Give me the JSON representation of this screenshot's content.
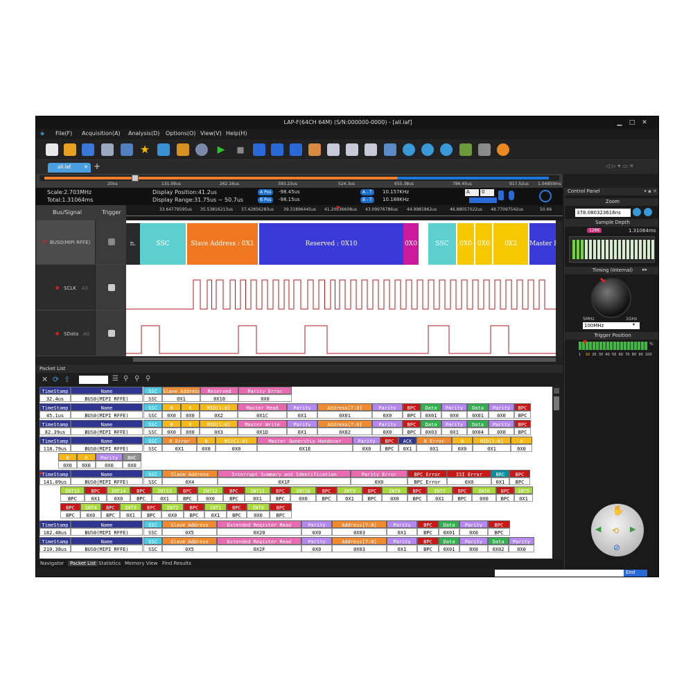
{
  "window": {
    "title": "LAP-F(64CH 64M) (S/N:000000-0000) - [all.laf]"
  },
  "menu": [
    "File(F)",
    "Acquisition(A)",
    "Analysis(D)",
    "Options(O)",
    "View(V)",
    "Help(H)"
  ],
  "tab": {
    "name": "all.laf"
  },
  "ruler": {
    "ticks": [
      "20ns",
      "131.09us",
      "262.16us",
      "393.23us",
      "524.3us",
      "655.38us",
      "786.45us",
      "917.52us",
      "1.04859ms"
    ]
  },
  "info": {
    "scale": "Scale:2.703MHz",
    "total": "Total:1.31064ms",
    "display_position": "Display Position:41.2us",
    "display_range": "Display Range:31.75us ~ 50.7us",
    "a_pos_label": "A Pos",
    "a_pos": "-98.45us",
    "b_pos_label": "B Pos",
    "b_pos": "-98.15us",
    "at_label": "A - T",
    "at": "10.157KHz",
    "bt_label": "B - T",
    "bt": "10.188KHz",
    "sel_a": "A",
    "sel_0": "0"
  },
  "header": {
    "bus_signal": "Bus/Signal",
    "trigger": "Trigger"
  },
  "time_ticks": [
    "33.64779595us",
    "35.53816213us",
    "37.42856283us",
    "39.31896445us",
    "41.20936608us",
    "43.09976786us",
    "44.9981962us",
    "46.88057022us",
    "48.77097542us",
    "50.66"
  ],
  "signals": [
    {
      "name": "BUS0(MIPI RFFE)"
    },
    {
      "name": "SCLK",
      "ch": "A1"
    },
    {
      "name": "SData",
      "ch": "A0"
    }
  ],
  "bus_segments": [
    {
      "label": "n.",
      "color": "#2a2a2a",
      "text_color": "#ddd"
    },
    {
      "label": "SSC",
      "color": "#5ecfcf",
      "text_color": "#fff"
    },
    {
      "label": "Slave Address : 0X1",
      "color": "#f07820",
      "text_color": "#fff"
    },
    {
      "label": "Reserved : 0X10",
      "color": "#3a3ad8",
      "text_color": "#fff"
    },
    {
      "label": "0X0",
      "color": "#cc1a9c",
      "text_color": "#fff"
    },
    {
      "label": "SSC",
      "color": "#5ecfcf",
      "text_color": "#fff"
    },
    {
      "label": "0X0",
      "color": "#f5c800",
      "text_color": "#fff"
    },
    {
      "label": "0X0",
      "color": "#f5c800",
      "text_color": "#fff"
    },
    {
      "label": "0X2",
      "color": "#f5c800",
      "text_color": "#fff"
    },
    {
      "label": "Master R",
      "color": "#3a3ad8",
      "text_color": "#fff"
    }
  ],
  "control_panel": {
    "title": "Control Panel",
    "zoom": "Zoom",
    "zoom_value": "378.080323616ns",
    "sample_depth": "Sample Depth",
    "depth_marker": "128K",
    "depth_value": "1.31064ms",
    "timing": "Timing (Internal)",
    "dial_min": "5MHz",
    "dial_max": "1GHz",
    "rate": "100MHz",
    "trigger_position": "Trigger Position",
    "percent_label": "%",
    "trigger_scale": [
      "1",
      "10",
      "20",
      "30",
      "40",
      "50",
      "60",
      "70",
      "80",
      "90",
      "100"
    ]
  },
  "packet_list": {
    "title": "Packet List"
  },
  "bottom_tabs": [
    "Navigator",
    "Packet List",
    "Statistics",
    "Memory View",
    "Find Results"
  ],
  "status": {
    "end": "End"
  },
  "colors": {
    "navy": "#2d3590",
    "cyan": "#52c8e0",
    "orange": "#f08a30",
    "pink": "#e86ab0",
    "purple": "#b488f0",
    "red": "#c81818",
    "green": "#34b050",
    "lime": "#a8d83c",
    "yellow": "#f5b81a",
    "teal": "#0090a0",
    "gray": "#909090"
  }
}
